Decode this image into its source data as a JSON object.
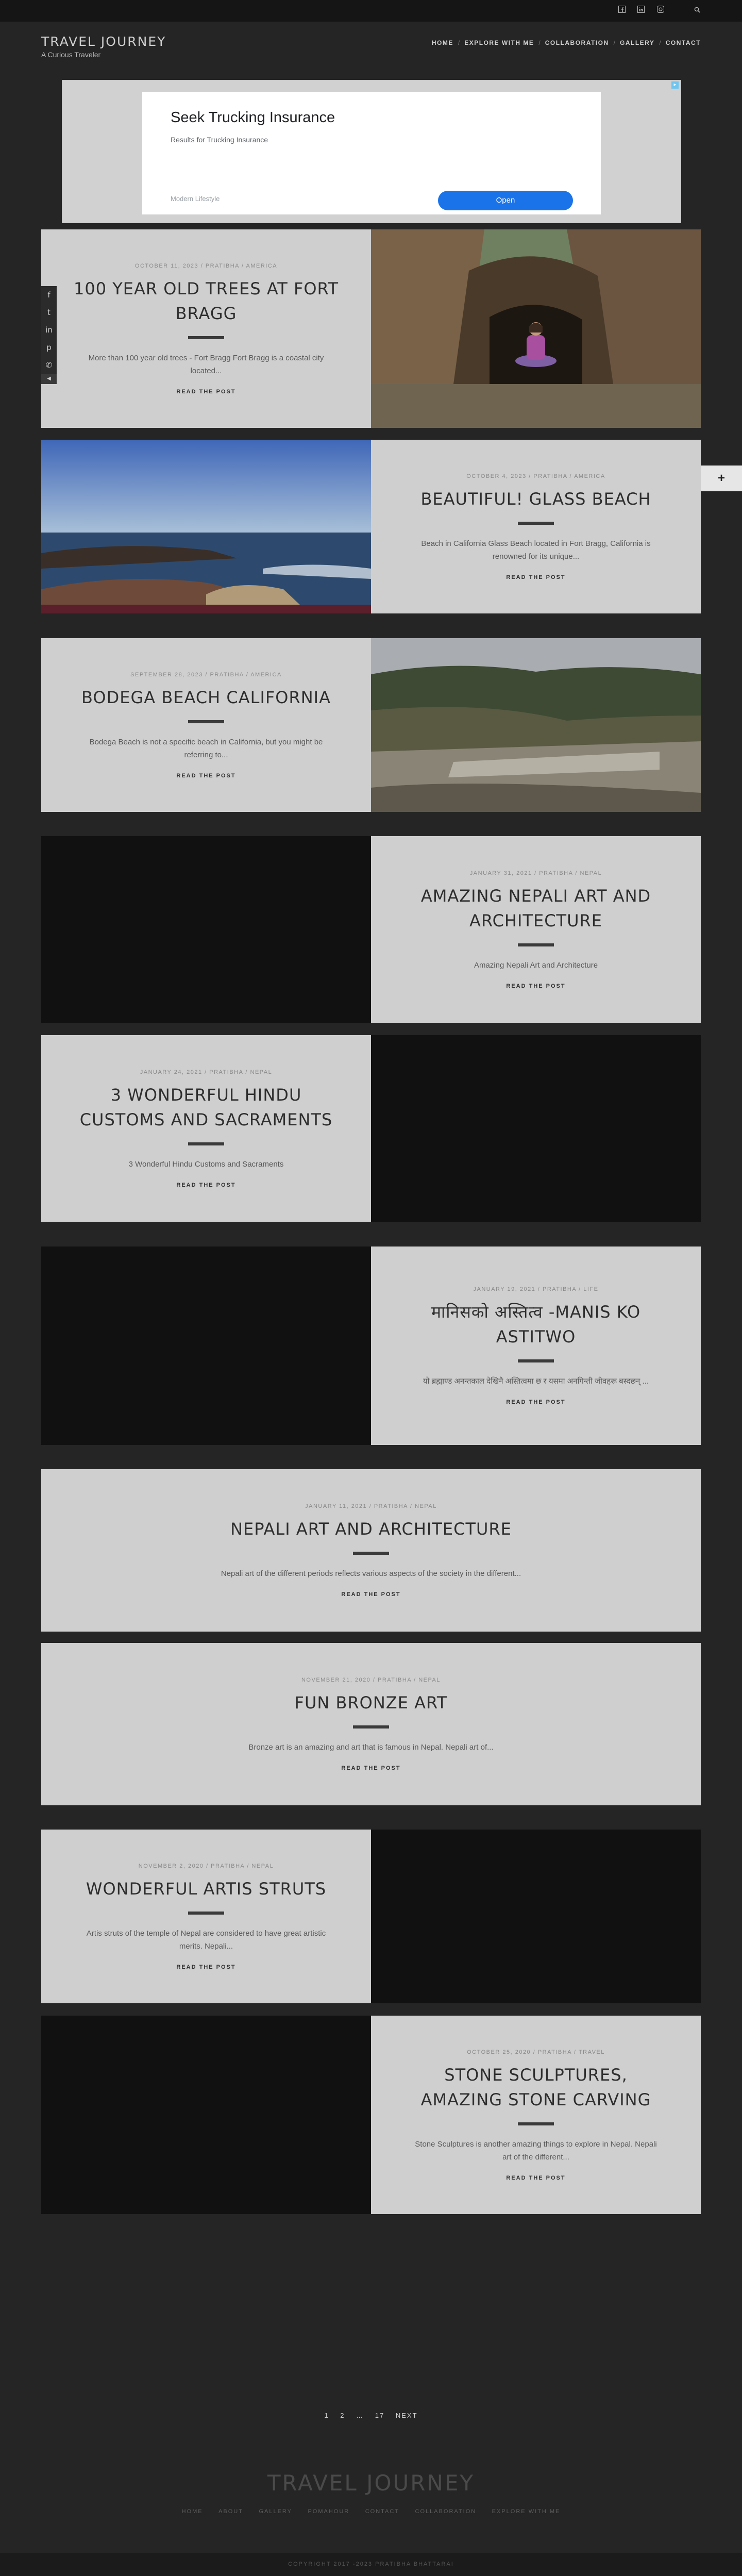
{
  "site": {
    "title": "TRAVEL JOURNEY",
    "tagline": "A Curious Traveler"
  },
  "nav": {
    "home": "HOME",
    "explore": "EXPLORE WITH ME",
    "collab": "COLLABORATION",
    "gallery": "GALLERY",
    "contact": "CONTACT",
    "sep": "/"
  },
  "topbar_icons": [
    "facebook-icon",
    "linkedin-icon",
    "instagram-icon",
    "search-icon"
  ],
  "ad": {
    "headline": "Seek Trucking Insurance",
    "sub": "Results for Trucking Insurance",
    "advertiser": "Modern Lifestyle",
    "button": "Open"
  },
  "share_icons": [
    "facebook-icon",
    "twitter-icon",
    "linkedin-icon",
    "pinterest-icon",
    "whatsapp-icon"
  ],
  "read_more": "READ THE POST",
  "posts": [
    {
      "meta": "OCTOBER 11, 2023 / PRATIBHA / AMERICA",
      "title": "100 YEAR OLD TREES AT FORT BRAGG",
      "excerpt": "More than 100 year old trees - Fort Bragg Fort Bragg is a coastal city located..."
    },
    {
      "meta": "OCTOBER 4, 2023 / PRATIBHA / AMERICA",
      "title": "BEAUTIFUL! GLASS BEACH",
      "excerpt": "Beach in California Glass Beach located in Fort Bragg, California is renowned for its unique..."
    },
    {
      "meta": "SEPTEMBER 28, 2023 / PRATIBHA / AMERICA",
      "title": "BODEGA BEACH CALIFORNIA",
      "excerpt": "Bodega Beach is not a specific beach in California, but you might be referring to..."
    },
    {
      "meta": "JANUARY 31, 2021 / PRATIBHA / NEPAL",
      "title": "AMAZING NEPALI ART AND ARCHITECTURE",
      "excerpt": "Amazing Nepali Art and Architecture"
    },
    {
      "meta": "JANUARY 24, 2021 / PRATIBHA / NEPAL",
      "title": "3 WONDERFUL HINDU CUSTOMS AND SACRAMENTS",
      "excerpt": "3 Wonderful Hindu Customs and Sacraments"
    },
    {
      "meta": "JANUARY 19, 2021 / PRATIBHA / LIFE",
      "title": "मानिसको अस्तित्व -MANIS KO ASTITWO",
      "excerpt": "यो ब्रह्माण्ड अनन्तकाल देखिनै अस्तित्वमा छ र यसमा अनगिन्ती जीवहरू बस्दछन् ..."
    },
    {
      "meta": "JANUARY 11, 2021 / PRATIBHA / NEPAL",
      "title": "NEPALI ART AND ARCHITECTURE",
      "excerpt": "Nepali art of the different periods reflects various aspects of the society in the different..."
    },
    {
      "meta": "NOVEMBER 21, 2020 / PRATIBHA / NEPAL",
      "title": "FUN BRONZE ART",
      "excerpt": "Bronze art is an amazing and art that is famous in Nepal. Nepali art of..."
    },
    {
      "meta": "NOVEMBER 2, 2020 / PRATIBHA / NEPAL",
      "title": "WONDERFUL ARTIS STRUTS",
      "excerpt": "Artis struts of the temple of Nepal are considered to have great artistic merits. Nepali..."
    },
    {
      "meta": "OCTOBER 25, 2020 / PRATIBHA / TRAVEL",
      "title": "STONE SCULPTURES, AMAZING STONE CARVING",
      "excerpt": "Stone Sculptures is another amazing things to explore in Nepal. Nepali art of the different..."
    }
  ],
  "pager": {
    "p1": "1",
    "p2": "2",
    "dots": "…",
    "p17": "17",
    "next": "NEXT"
  },
  "footer": {
    "brand": "TRAVEL JOURNEY",
    "links": [
      "HOME",
      "ABOUT",
      "GALLERY",
      "POMAHOUR",
      "CONTACT",
      "COLLABORATION",
      "EXPLORE WITH ME"
    ],
    "copyright": "COPYRIGHT 2017 -2023 PRATIBHA BHATTARAI"
  },
  "side_button": "+"
}
